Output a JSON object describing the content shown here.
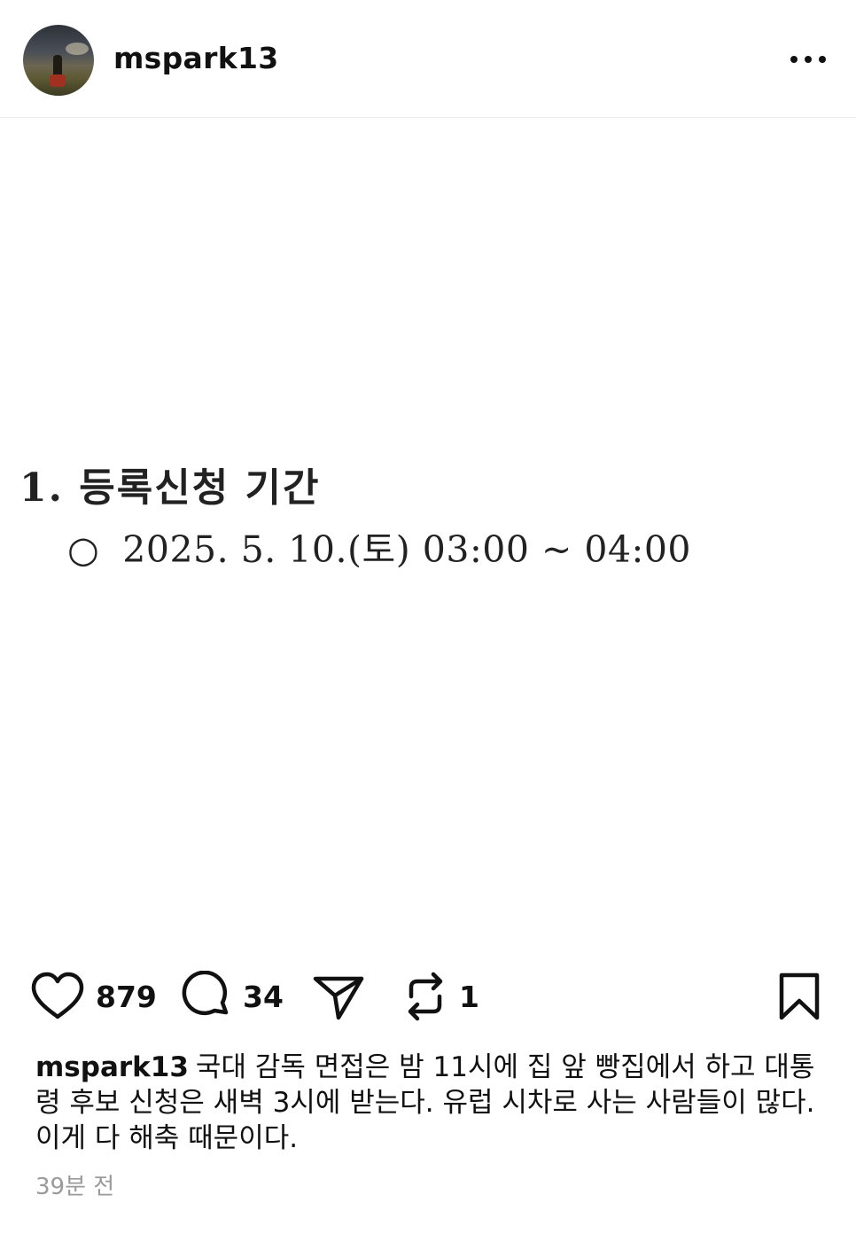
{
  "header": {
    "username": "mspark13"
  },
  "post_image": {
    "heading": "1. 등록신청 기간",
    "bullet": "○",
    "line": "2025. 5. 10.(토) 03:00 ~ 04:00"
  },
  "actions": {
    "likes": "879",
    "comments": "34",
    "reposts": "1"
  },
  "caption": {
    "username": "mspark13",
    "text": "국대 감독 면접은 밤 11시에 집 앞 빵집에서 하고 대통령 후보 신청은 새벽 3시에 받는다. 유럽 시차로 사는 사람들이 많다. 이게 다 해축 때문이다."
  },
  "timestamp": "39분 전",
  "icons": {
    "avatar": "avatar-photo",
    "more": "more-horizontal-icon",
    "like": "heart-icon",
    "comment": "comment-bubble-icon",
    "share": "send-icon",
    "repost": "repost-icon",
    "save": "bookmark-icon"
  }
}
